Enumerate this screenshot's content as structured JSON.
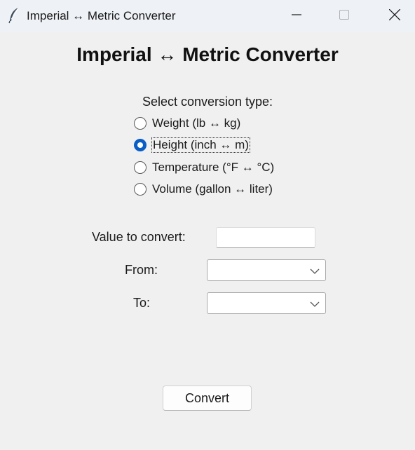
{
  "window": {
    "title": "Imperial ↔ Metric Converter",
    "icon": "feather-icon",
    "controls": [
      "minimize-icon",
      "maximize-icon",
      "close-icon"
    ]
  },
  "main": {
    "heading": "Imperial ↔ Metric Converter",
    "select_label": "Select conversion type:",
    "conversion_types": [
      {
        "label": "Weight (lb ↔ kg)",
        "checked": false
      },
      {
        "label": "Height (inch ↔ m)",
        "checked": true
      },
      {
        "label": "Temperature (°F ↔ °C)",
        "checked": false
      },
      {
        "label": "Volume (gallon ↔ liter)",
        "checked": false
      }
    ],
    "value_label": "Value to convert:",
    "value": "",
    "from_label": "From:",
    "from_value": "",
    "to_label": "To:",
    "to_value": "",
    "convert_label": "Convert"
  },
  "colors": {
    "accent": "#0a5cc7",
    "background": "#f0f0f0",
    "titlebar": "#eef1f6"
  }
}
